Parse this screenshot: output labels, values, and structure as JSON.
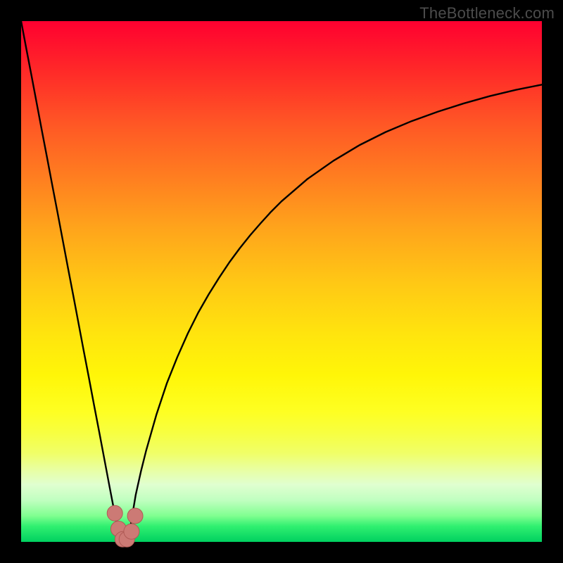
{
  "watermark_text": "TheBottleneck.com",
  "colors": {
    "frame": "#000000",
    "curve_stroke": "#000000",
    "marker_fill": "#cc7a75",
    "marker_stroke": "#b05a55",
    "watermark": "#4c4c4c"
  },
  "chart_data": {
    "type": "line",
    "title": "",
    "xlabel": "",
    "ylabel": "",
    "xlim": [
      0,
      100
    ],
    "ylim": [
      0,
      100
    ],
    "x": [
      0,
      1,
      2,
      3,
      4,
      5,
      6,
      7,
      8,
      9,
      10,
      11,
      12,
      13,
      14,
      15,
      16,
      17,
      18,
      18.5,
      19,
      19.5,
      20,
      20.5,
      21,
      21.5,
      22,
      23,
      24,
      25,
      26,
      27,
      28,
      30,
      32,
      34,
      36,
      38,
      40,
      42,
      44,
      46,
      48,
      50,
      55,
      60,
      65,
      70,
      75,
      80,
      85,
      90,
      95,
      100
    ],
    "y": [
      100,
      94.7,
      89.5,
      84.2,
      78.9,
      73.7,
      68.4,
      63.2,
      57.9,
      52.6,
      47.4,
      42.1,
      36.8,
      31.6,
      26.3,
      21.1,
      15.8,
      10.5,
      5.3,
      3.0,
      1.0,
      0.0,
      0.0,
      1.0,
      3.0,
      6.0,
      9.0,
      13.5,
      17.5,
      21.0,
      24.5,
      27.5,
      30.5,
      35.5,
      40.0,
      44.0,
      47.5,
      50.7,
      53.7,
      56.4,
      58.9,
      61.2,
      63.4,
      65.4,
      69.7,
      73.2,
      76.2,
      78.7,
      80.8,
      82.6,
      84.2,
      85.6,
      86.8,
      87.8
    ],
    "markers": {
      "x": [
        18.0,
        18.7,
        19.5,
        20.3,
        21.2,
        21.9
      ],
      "y": [
        5.5,
        2.5,
        0.5,
        0.5,
        2.0,
        5.0
      ]
    },
    "notes": "x and y are in percent of plot-area width/height; y=0 at bottom (green) rising to y=100 at top (red). Curve descends sharply from top-left to a cusp near x≈19.5, then rises with decreasing slope toward upper right. Axis tick labels are absent in the source image."
  }
}
